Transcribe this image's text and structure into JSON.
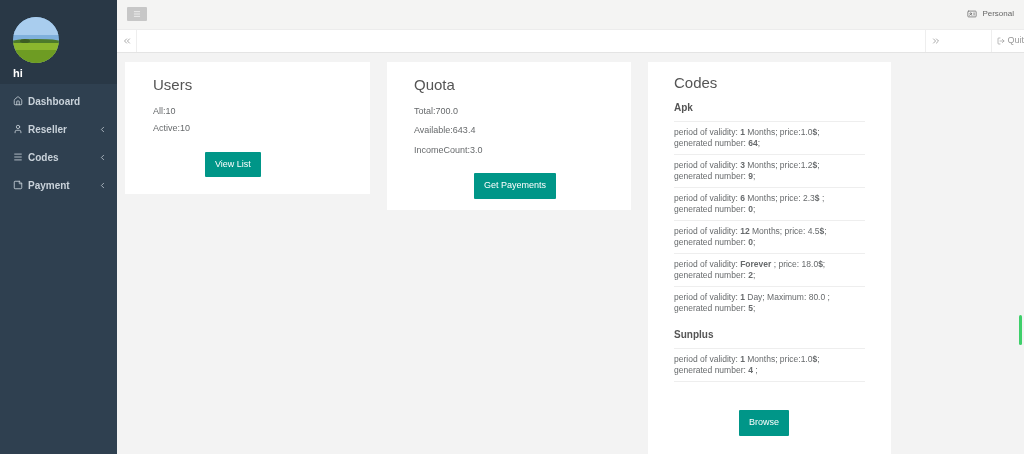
{
  "sidebar": {
    "user_name": "hi",
    "items": [
      {
        "label": "Dashboard",
        "has_submenu": false
      },
      {
        "label": "Reseller",
        "has_submenu": true
      },
      {
        "label": "Codes",
        "has_submenu": true
      },
      {
        "label": "Payment",
        "has_submenu": true
      }
    ]
  },
  "header": {
    "personal": "Personal",
    "quit": "Quit"
  },
  "users": {
    "title": "Users",
    "lines": [
      "All:10",
      "Active:10"
    ],
    "button": "View List"
  },
  "quota": {
    "title": "Quota",
    "lines": [
      "Total:700.0",
      "Available:643.4",
      "IncomeCount:3.0"
    ],
    "button": "Get Payements"
  },
  "codes": {
    "title": "Codes",
    "groups": [
      {
        "name": "Apk",
        "entries": [
          [
            "period of validity: **1** Months; price:1.0**$**;",
            "generated number: **64**;"
          ],
          [
            "period of validity: **3** Months; price:1.2**$**;",
            "generated number: **9**;"
          ],
          [
            "period of validity: **6** Months; price: 2.3**$** ;",
            "generated number: **0**;"
          ],
          [
            "period of validity: **12** Months; price: 4.5**$**;",
            "generated number: **0**;"
          ],
          [
            "period of validity: **Forever** ; price: 18.0**$**;",
            "generated number: **2**;"
          ],
          [
            "period of validity: **1** Day; Maximum: 80.0 ;",
            "generated number: **5**;"
          ]
        ]
      },
      {
        "name": "Sunplus",
        "entries": [
          [
            "period of validity: **1** Months; price:1.0**$**;",
            "generated number: **4** ;"
          ]
        ]
      }
    ],
    "button": "Browse"
  }
}
